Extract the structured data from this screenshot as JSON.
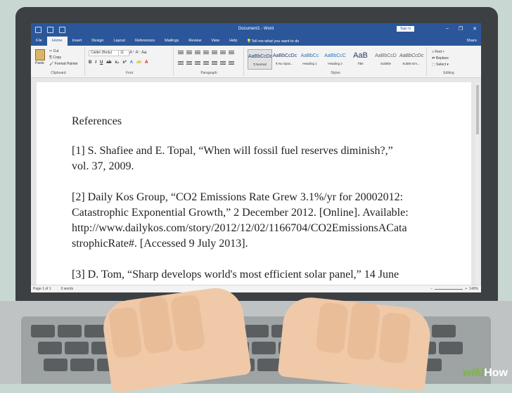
{
  "window": {
    "title": "Document1 - Word",
    "signin_label": "Sign in",
    "minimize": "–",
    "restore": "❐",
    "close": "✕"
  },
  "menu": {
    "tabs": [
      "File",
      "Home",
      "Insert",
      "Design",
      "Layout",
      "References",
      "Mailings",
      "Review",
      "View",
      "Help"
    ],
    "tell_me": "Tell me what you want to do",
    "share": "Share"
  },
  "ribbon": {
    "clipboard": {
      "paste": "Paste",
      "cut": "Cut",
      "copy": "Copy",
      "format_painter": "Format Painter",
      "group_name": "Clipboard"
    },
    "font": {
      "font_name": "Calibri (Body)",
      "font_size": "11",
      "bold": "B",
      "italic": "I",
      "underline": "U",
      "group_name": "Font"
    },
    "paragraph": {
      "group_name": "Paragraph"
    },
    "styles": {
      "items": [
        {
          "sample": "AaBbCcDc",
          "name": "¶ Normal"
        },
        {
          "sample": "AaBbCcDc",
          "name": "¶ No Spac..."
        },
        {
          "sample": "AaBbCc",
          "name": "Heading 1"
        },
        {
          "sample": "AaBbCcC",
          "name": "Heading 2"
        },
        {
          "sample": "AaB",
          "name": "Title"
        },
        {
          "sample": "AaBbCcD",
          "name": "Subtitle"
        },
        {
          "sample": "AaBbCcDc",
          "name": "Subtle Em..."
        }
      ],
      "group_name": "Styles"
    },
    "editing": {
      "find": "Find",
      "replace": "Replace",
      "select": "Select",
      "group_name": "Editing"
    }
  },
  "document": {
    "heading": "References",
    "entries": [
      [
        "[1] S. Shafiee and E. Topal, “When will fossil fuel reserves diminish?,”",
        "vol. 37, 2009."
      ],
      [
        "[2] Daily Kos Group, “CO2 Emissions Rate Grew 3.1%/yr for 20002012:",
        "Catastrophic Exponential Growth,” 2 December 2012. [Online]. Available:",
        "http://www.dailykos.com/story/2012/12/02/1166704/CO2EmissionsACata",
        "strophicRate#. [Accessed 9 July 2013]."
      ],
      [
        "[3] D. Tom, “Sharp develops world's most efficient solar panel,” 14 June"
      ]
    ]
  },
  "status": {
    "page": "Page 1 of 1",
    "words": "0 words",
    "zoom": "140%"
  },
  "watermark": {
    "wiki": "wiki",
    "how": "How"
  },
  "colors": {
    "word_blue": "#2b579a",
    "ribbon_bg": "#f3f3f3",
    "laptop_bezel": "#3d4043"
  }
}
